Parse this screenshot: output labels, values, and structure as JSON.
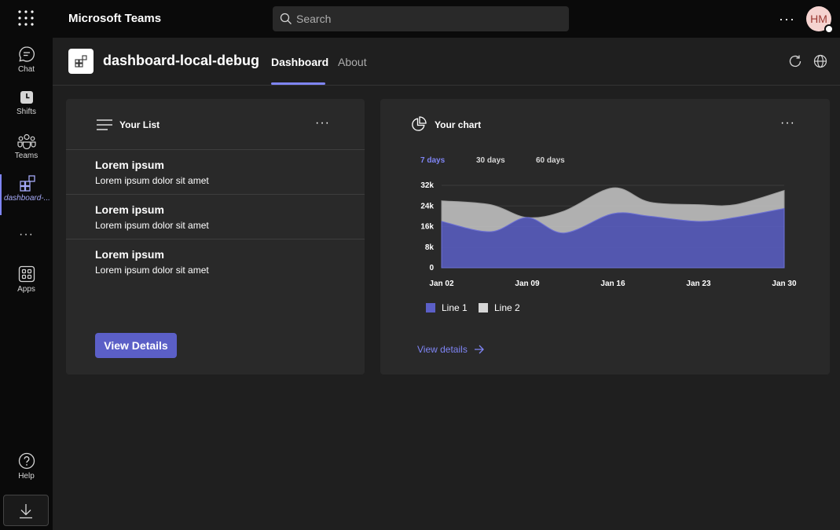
{
  "topbar": {
    "app_title": "Microsoft Teams",
    "search_placeholder": "Search",
    "avatar_initials": "HM"
  },
  "rail": {
    "items": [
      {
        "label": "Chat",
        "icon": "chat-icon"
      },
      {
        "label": "Shifts",
        "icon": "shifts-icon"
      },
      {
        "label": "Teams",
        "icon": "teams-icon"
      },
      {
        "label": "dashboard-...",
        "icon": "app-grid-icon",
        "active": true
      },
      {
        "label": "Apps",
        "icon": "apps-icon"
      },
      {
        "label": "Help",
        "icon": "help-icon"
      }
    ]
  },
  "app_header": {
    "name": "dashboard-local-debug",
    "tabs": [
      {
        "label": "Dashboard",
        "active": true
      },
      {
        "label": "About"
      }
    ]
  },
  "list_card": {
    "title": "Your List",
    "items": [
      {
        "title": "Lorem ipsum",
        "subtitle": "Lorem ipsum dolor sit amet"
      },
      {
        "title": "Lorem ipsum",
        "subtitle": "Lorem ipsum dolor sit amet"
      },
      {
        "title": "Lorem ipsum",
        "subtitle": "Lorem ipsum dolor sit amet"
      }
    ],
    "button_label": "View Details"
  },
  "chart_card": {
    "title": "Your chart",
    "ranges": [
      "7 days",
      "30 days",
      "60 days"
    ],
    "active_range": "7 days",
    "link_label": "View details"
  },
  "colors": {
    "accent": "#7f85f5",
    "brand_button": "#5b5fc7",
    "line1": "#5b5fc7",
    "line2": "#c8c8c8"
  },
  "chart_data": {
    "type": "area",
    "stacked": true,
    "x": [
      "Jan 02",
      "Jan 09",
      "Jan 16",
      "Jan 23",
      "Jan 30"
    ],
    "x_days": [
      2,
      6,
      9,
      12,
      16,
      19,
      23,
      26,
      30
    ],
    "series": [
      {
        "name": "Line 1",
        "values": [
          18000,
          14000,
          19500,
          13500,
          21000,
          20000,
          18000,
          19500,
          23000
        ]
      },
      {
        "name": "Line 2",
        "values": [
          8000,
          10500,
          0,
          8500,
          10000,
          5500,
          6500,
          5000,
          7000
        ]
      }
    ],
    "yticks": [
      "0",
      "8k",
      "16k",
      "24k",
      "32k"
    ],
    "ylim": [
      0,
      32000
    ],
    "grid": true,
    "legend": "bottom-left"
  }
}
